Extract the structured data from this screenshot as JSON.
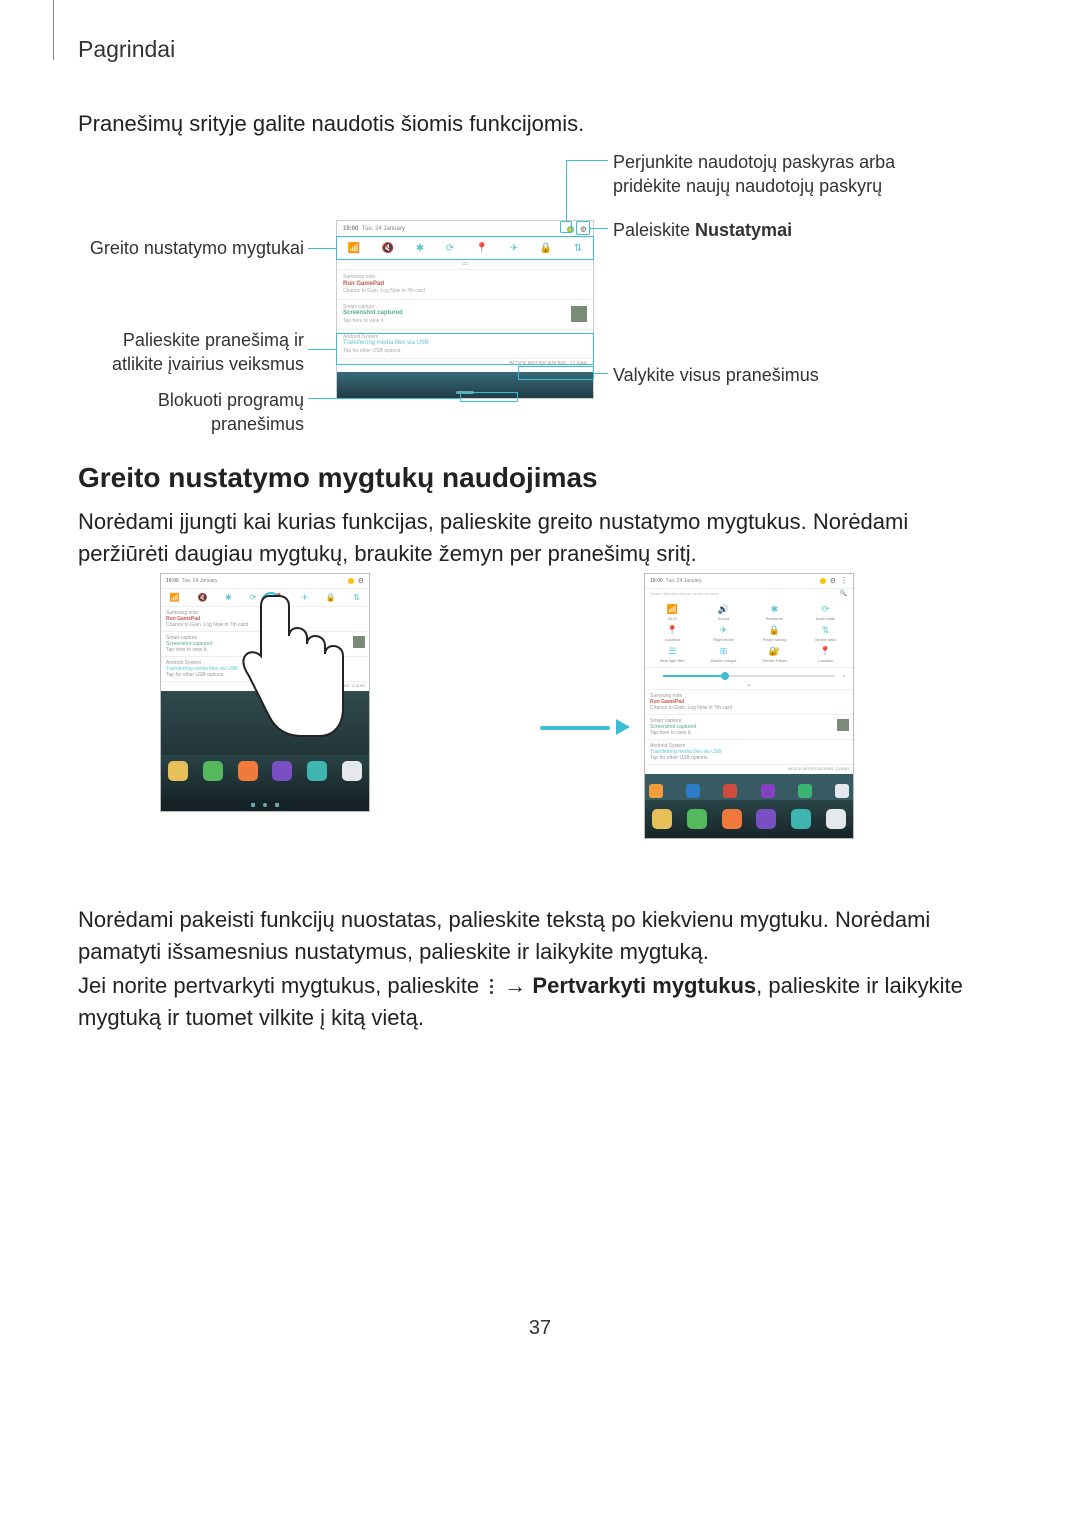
{
  "header": {
    "section": "Pagrindai"
  },
  "intro": "Pranešimų srityje galite naudotis šiomis funkcijomis.",
  "callouts": {
    "quick_settings": "Greito nustatymo mygtukai",
    "tap_notification": "Palieskite pranešimą ir atlikite įvairius veiksmus",
    "block_notifications": "Blokuoti programų pranešimus",
    "switch_users": "Perjunkite naudotojų paskyras arba pridėkite naujų naudotojų paskyrų",
    "launch_settings_pre": "Paleiskite ",
    "launch_settings_bold": "Nustatymai",
    "clear_all": "Valykite visus pranešimus"
  },
  "h2": "Greito nustatymo mygtukų naudojimas",
  "p1": "Norėdami įjungti kai kurias funkcijas, palieskite greito nustatymo mygtukus. Norėdami peržiūrėti daugiau mygtukų, braukite žemyn per pranešimų sritį.",
  "p2": "Norėdami pakeisti funkcijų nuostatas, palieskite tekstą po kiekvienu mygtuku. Norėdami pamatyti išsamesnius nustatymus, palieskite ir laikykite mygtuką.",
  "p3_a": "Jei norite pertvarkyti mygtukus, palieskite ",
  "p3_b": " → ",
  "p3_bold": "Pertvarkyti mygtukus",
  "p3_c": ", palieskite ir laikykite mygtuką ir tuomet vilkite į kitą vietą.",
  "shot": {
    "time": "19:00",
    "date": "Tue, 24 January",
    "search_placeholder": "Search features and qu ck act on pane",
    "qs_icons": [
      "📶",
      "🔇",
      "✱",
      "⟳",
      "📍",
      "✈",
      "🔒",
      "⇅"
    ],
    "notif1": {
      "app": "Samsung note",
      "title": "Run GamePad",
      "sub": "Chance to Gain. Log Now in 7th card"
    },
    "notif2": {
      "app": "Smart capture",
      "title": "Screenshot captured",
      "sub": "Tap here to view it."
    },
    "notif3": {
      "app": "Android System",
      "title": "Transferring media files via USB",
      "sub": "Tap for other USB options."
    },
    "footer": {
      "block": "BLOCK NOTIFICATIONS",
      "clear": "CLEAR"
    }
  },
  "qs_grid": [
    {
      "icon": "📶",
      "label": "Wi-Fi"
    },
    {
      "icon": "🔊",
      "label": "Sound"
    },
    {
      "icon": "✱",
      "label": "Bluetooth"
    },
    {
      "icon": "⟳",
      "label": "Auto rotate"
    },
    {
      "icon": "📍",
      "label": "Location"
    },
    {
      "icon": "✈",
      "label": "Flight mode"
    },
    {
      "icon": "🔒",
      "label": "Power saving"
    },
    {
      "icon": "⇅",
      "label": "Mobile data"
    },
    {
      "icon": "☰",
      "label": "Blue light filter"
    },
    {
      "icon": "⊞",
      "label": "Mobile hotspot"
    },
    {
      "icon": "🔐",
      "label": "Secure Folder"
    },
    {
      "icon": "📍",
      "label": "Location"
    }
  ],
  "dock": [
    {
      "color": "#f39c3c"
    },
    {
      "color": "#2a7cc4"
    },
    {
      "color": "#d14b3c"
    },
    {
      "color": "#8543c4"
    },
    {
      "color": "#39b571"
    },
    {
      "color": "#e5e9ec"
    }
  ],
  "bottom_dock": [
    {
      "color": "#e8c05a"
    },
    {
      "color": "#54b85c"
    },
    {
      "color": "#f07a3c"
    },
    {
      "color": "#7a4fc4"
    },
    {
      "color": "#3fb5b0"
    },
    {
      "color": "#e5e9ec"
    }
  ],
  "page": "37"
}
